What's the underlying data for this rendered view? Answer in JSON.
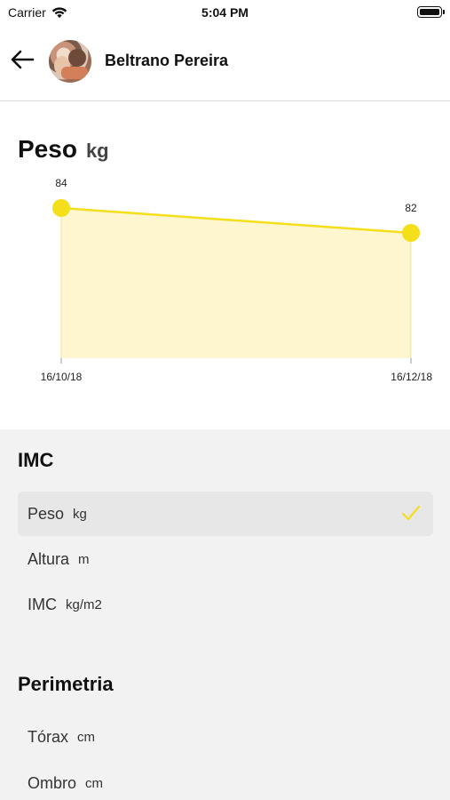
{
  "status_bar": {
    "carrier": "Carrier",
    "time": "5:04 PM"
  },
  "header": {
    "user_name": "Beltrano Pereira"
  },
  "chart_section": {
    "title": "Peso",
    "unit": "kg"
  },
  "chart_data": {
    "type": "area",
    "x": [
      "16/10/18",
      "16/12/18"
    ],
    "values": [
      84,
      82
    ],
    "data_labels": [
      "84",
      "82"
    ],
    "color": "#f5de1a",
    "fill_color": "#fdf6cf"
  },
  "list": {
    "sections": [
      {
        "title": "IMC",
        "items": [
          {
            "label": "Peso",
            "unit": "kg",
            "selected": true
          },
          {
            "label": "Altura",
            "unit": "m",
            "selected": false
          },
          {
            "label": "IMC",
            "unit": "kg/m2",
            "selected": false
          }
        ]
      },
      {
        "title": "Perimetria",
        "items": [
          {
            "label": "Tórax",
            "unit": "cm",
            "selected": false
          },
          {
            "label": "Ombro",
            "unit": "cm",
            "selected": false
          }
        ]
      }
    ]
  },
  "colors": {
    "accent": "#f5de1a",
    "list_background": "#f2f2f2",
    "selected_row": "#e7e7e7"
  },
  "icons": {
    "back": "arrow-left-icon",
    "check": "checkmark-icon",
    "wifi": "wifi-icon",
    "battery": "battery-icon"
  }
}
